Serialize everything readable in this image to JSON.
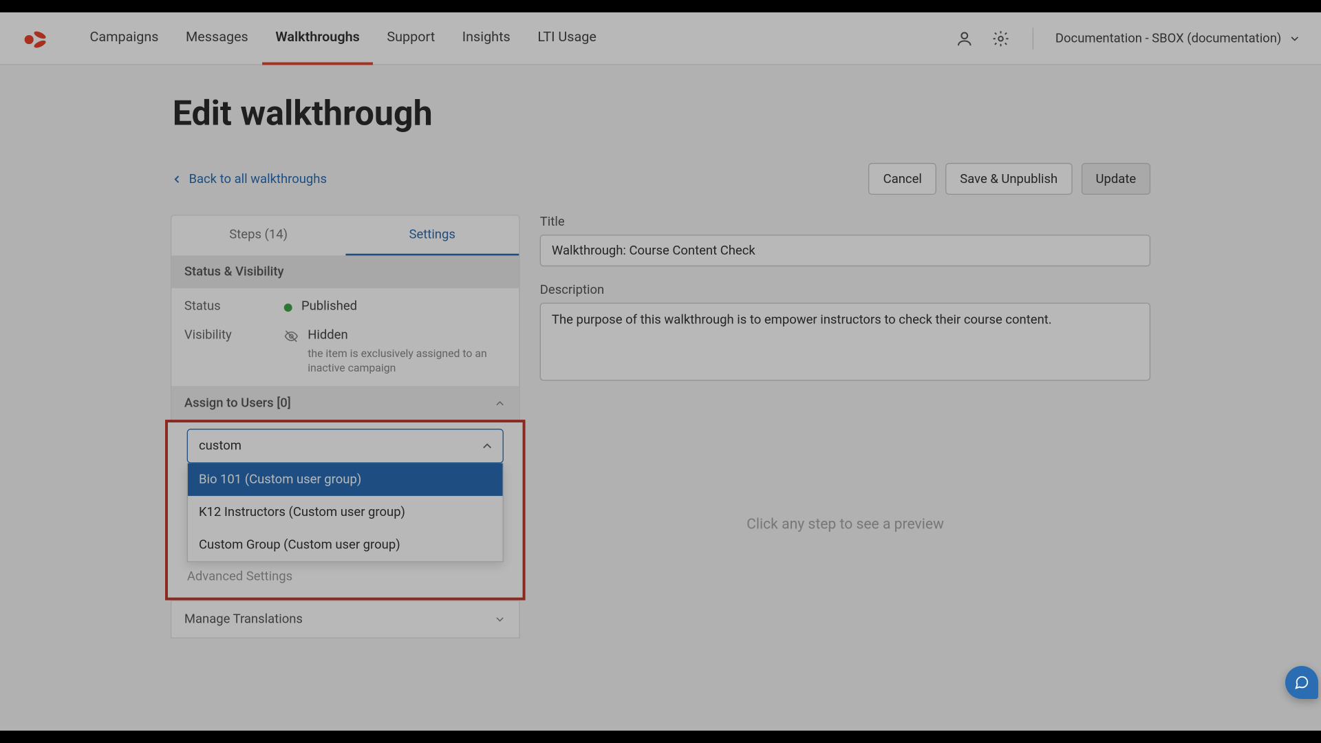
{
  "nav": {
    "items": [
      {
        "label": "Campaigns"
      },
      {
        "label": "Messages"
      },
      {
        "label": "Walkthroughs"
      },
      {
        "label": "Support"
      },
      {
        "label": "Insights"
      },
      {
        "label": "LTI Usage"
      }
    ],
    "active_index": 2,
    "workspace": "Documentation - SBOX (documentation)"
  },
  "page": {
    "title": "Edit walkthrough",
    "back_label": "Back to all walkthroughs",
    "buttons": {
      "cancel": "Cancel",
      "save_unpub": "Save & Unpublish",
      "update": "Update"
    }
  },
  "tabs": {
    "steps": "Steps (14)",
    "settings": "Settings"
  },
  "status_vis": {
    "header": "Status & Visibility",
    "status_label": "Status",
    "status_value": "Published",
    "visibility_label": "Visibility",
    "visibility_value": "Hidden",
    "visibility_note": "the item is exclusively assigned to an inactive campaign"
  },
  "assign": {
    "header": "Assign to Users [0]",
    "search_value": "custom",
    "options": [
      "Bio 101 (Custom user group)",
      "K12 Instructors (Custom user group)",
      "Custom Group (Custom user group)"
    ],
    "advanced_partial": "Advanced Settings"
  },
  "manage_translations": "Manage Translations",
  "form": {
    "title_label": "Title",
    "title_value": "Walkthrough: Course Content Check",
    "desc_label": "Description",
    "desc_value": "The purpose of this walkthrough is to empower instructors to check their course content."
  },
  "preview_hint": "Click any step to see a preview",
  "colors": {
    "accent": "#e8452a",
    "link": "#2a6db3",
    "highlight_border": "#c0392b"
  }
}
